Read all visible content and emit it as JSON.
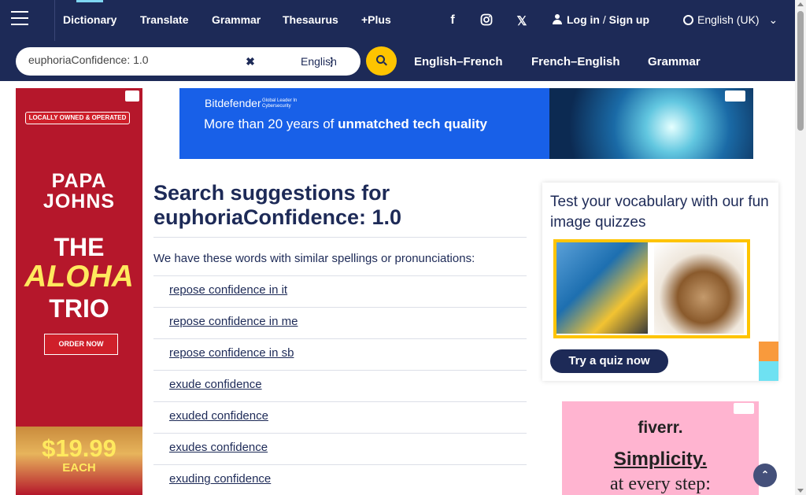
{
  "nav": {
    "items": [
      {
        "label": "Dictionary"
      },
      {
        "label": "Translate"
      },
      {
        "label": "Grammar"
      },
      {
        "label": "Thesaurus"
      },
      {
        "label": "+Plus"
      }
    ],
    "social": {
      "facebook": "f",
      "x": "𝕏"
    },
    "login": "Log in",
    "separator": "/",
    "signup": "Sign up",
    "language": "English (UK)",
    "chevron": "⌄",
    "menu_icon": "hamburger-icon"
  },
  "search": {
    "value": "euphoriaConfidence: 1.0",
    "clear": "✖",
    "dictionary": "English",
    "dots": "⋮",
    "quick_links": [
      "English–French",
      "French–English",
      "Grammar"
    ]
  },
  "main": {
    "heading_prefix": "Search suggestions for",
    "heading_term": "euphoriaConfidence: 1.0",
    "intro": "We have these words with similar spellings or pronunciations:",
    "suggestions": [
      "repose confidence in it",
      "repose confidence in me",
      "repose confidence in sb",
      "exude confidence",
      "exuded confidence",
      "exudes confidence",
      "exuding confidence"
    ]
  },
  "sidebar": {
    "quiz_title": "Test your vocabulary with our fun image quizzes",
    "quiz_button": "Try a quiz now"
  },
  "ads": {
    "left": {
      "badge": "LOCALLY OWNED & OPERATED",
      "brand_line1": "PAPA",
      "brand_line2": "JOHNS",
      "line_the": "THE",
      "line_aloha": "ALOHA",
      "line_trio": "TRIO",
      "cta": "ORDER NOW",
      "price": "$19.99",
      "each": "EACH"
    },
    "banner": {
      "brand": "Bitdefender",
      "tagline": "Global Leader In Cybersecurity",
      "message_plain": "More than 20 years of ",
      "message_bold": "unmatched tech quality"
    },
    "fiverr": {
      "logo": "fiverr.",
      "line1": "Simplicity.",
      "line2": "at every step:"
    }
  },
  "scroll_top_icon": "⌃",
  "colors": {
    "brand_navy": "#1d2a57",
    "accent_yellow": "#fec400"
  }
}
